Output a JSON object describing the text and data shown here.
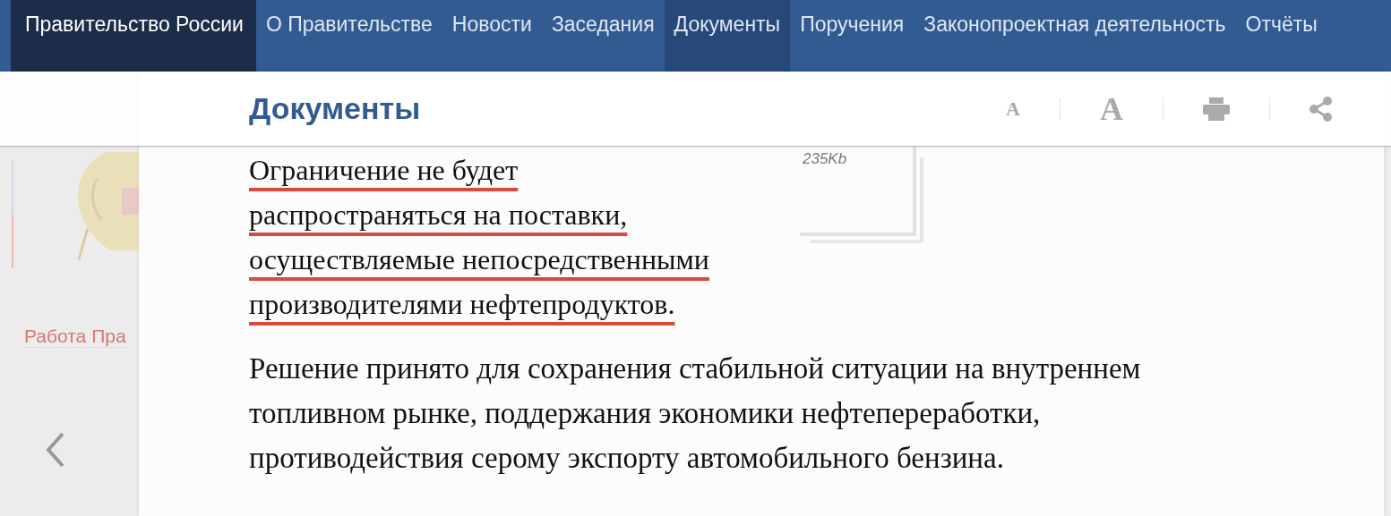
{
  "nav": {
    "items": [
      {
        "label": "Правительство России",
        "kind": "brand",
        "selected": false
      },
      {
        "label": "О Правительстве",
        "kind": "link",
        "selected": false
      },
      {
        "label": "Новости",
        "kind": "link",
        "selected": false
      },
      {
        "label": "Заседания",
        "kind": "link",
        "selected": false
      },
      {
        "label": "Документы",
        "kind": "link",
        "selected": true
      },
      {
        "label": "Поручения",
        "kind": "link",
        "selected": false
      },
      {
        "label": "Законопроектная деятельность",
        "kind": "link",
        "selected": false
      },
      {
        "label": "Отчёты",
        "kind": "link",
        "selected": false
      }
    ]
  },
  "header": {
    "title": "Документы",
    "tools": [
      {
        "kind": "font-small",
        "label": "A"
      },
      {
        "kind": "font-large",
        "label": "A"
      },
      {
        "kind": "print"
      },
      {
        "kind": "share"
      }
    ]
  },
  "sidebar": {
    "link": "Работа Пра"
  },
  "article": {
    "highlight": "Ограничение не будет распространяться на поставки, осуществляемые непосредственными производителями нефтепродуктов.",
    "paragraph": "Решение принято для сохранения стабильной ситуации на внутреннем топливном рынке, поддержания экономики нефтепереработки, противодействия серому экспорту автомобильного бензина."
  },
  "document": {
    "size": "235Kb"
  }
}
